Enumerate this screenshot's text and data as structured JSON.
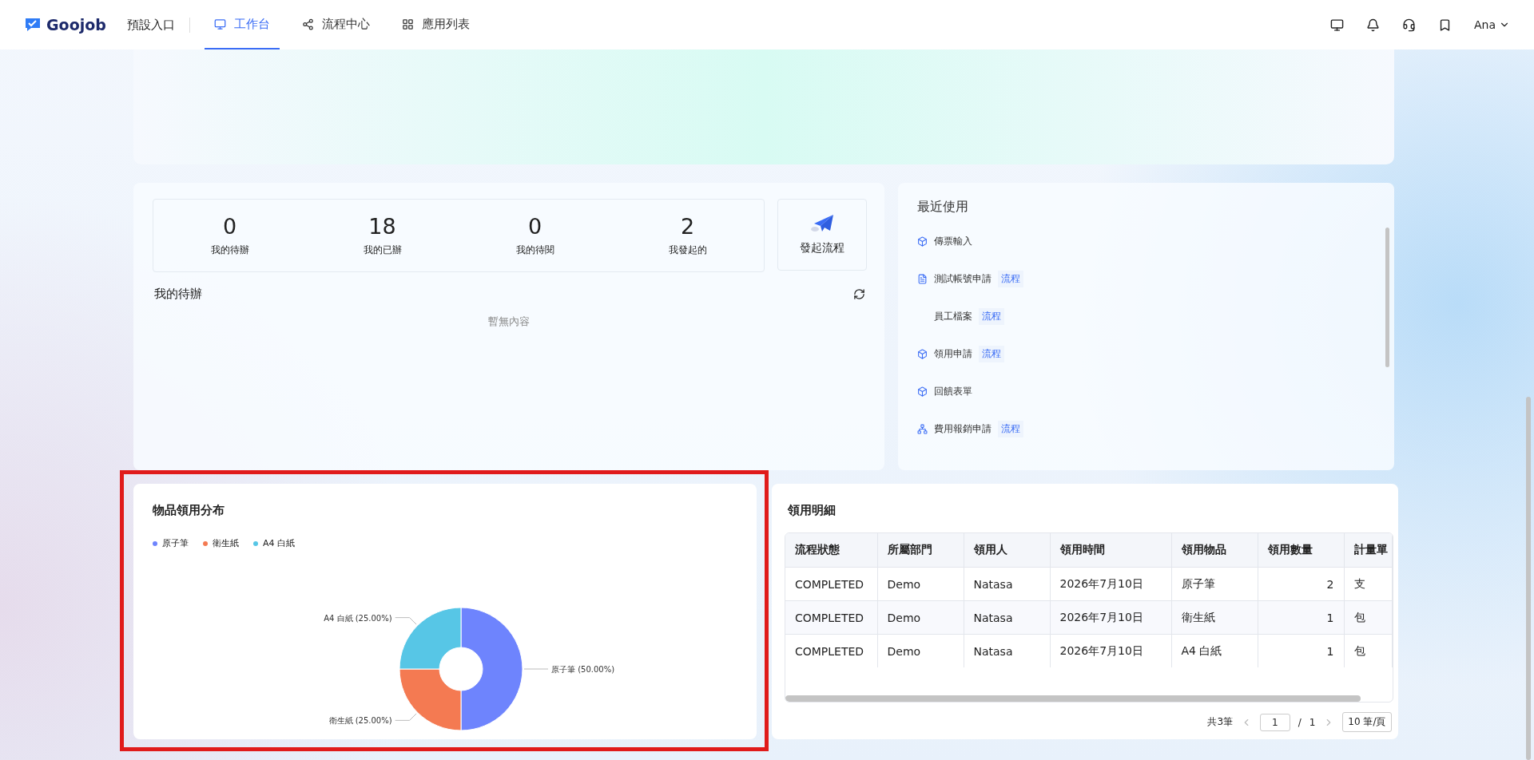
{
  "header": {
    "brand": "Goojob",
    "portal": "預設入口",
    "tabs": [
      {
        "label": "工作台",
        "selected": true
      },
      {
        "label": "流程中心",
        "selected": false
      },
      {
        "label": "應用列表",
        "selected": false
      }
    ],
    "user": "Ana"
  },
  "stats": [
    {
      "value": "0",
      "label": "我的待辦"
    },
    {
      "value": "18",
      "label": "我的已辦"
    },
    {
      "value": "0",
      "label": "我的待閱"
    },
    {
      "value": "2",
      "label": "我發起的"
    }
  ],
  "start_button": "發起流程",
  "todo": {
    "title": "我的待辦",
    "empty": "暫無內容"
  },
  "recent": {
    "title": "最近使用",
    "items": [
      {
        "label": "傳票輸入",
        "kind": "cube"
      },
      {
        "label": "測試帳號申請",
        "kind": "form",
        "tag": "流程"
      },
      {
        "label": "員工檔案",
        "kind": "plain",
        "tag": "流程"
      },
      {
        "label": "領用申請",
        "kind": "cube",
        "tag": "流程"
      },
      {
        "label": "回饋表單",
        "kind": "cube"
      },
      {
        "label": "費用報銷申請",
        "kind": "flow",
        "tag": "流程"
      }
    ]
  },
  "distribution": {
    "title": "物品領用分布",
    "chart_data": {
      "type": "donut",
      "categories": [
        "原子筆",
        "衛生紙",
        "A4 白紙"
      ],
      "values": [
        50,
        25,
        25
      ],
      "colors": [
        "#6e84fd",
        "#f47a52",
        "#57c6e6"
      ],
      "value_labels": [
        "原子筆 (50.00%)",
        "衛生紙 (25.00%)",
        "A4 白紙 (25.00%)"
      ]
    }
  },
  "details": {
    "title": "領用明細",
    "table": {
      "columns": [
        "流程狀態",
        "所屬部門",
        "領用人",
        "領用時間",
        "領用物品",
        "領用數量",
        "計量單"
      ],
      "rows": [
        [
          "COMPLETED",
          "Demo",
          "Natasa",
          "2026年7月10日",
          "原子筆",
          "2",
          "支"
        ],
        [
          "COMPLETED",
          "Demo",
          "Natasa",
          "2026年7月10日",
          "衛生紙",
          "1",
          "包"
        ],
        [
          "COMPLETED",
          "Demo",
          "Natasa",
          "2026年7月10日",
          "A4 白紙",
          "1",
          "包"
        ]
      ]
    },
    "pagination": {
      "total": "共3筆",
      "page": "1",
      "separator": "/",
      "pages": "1",
      "page_size": "10 筆/頁"
    }
  }
}
